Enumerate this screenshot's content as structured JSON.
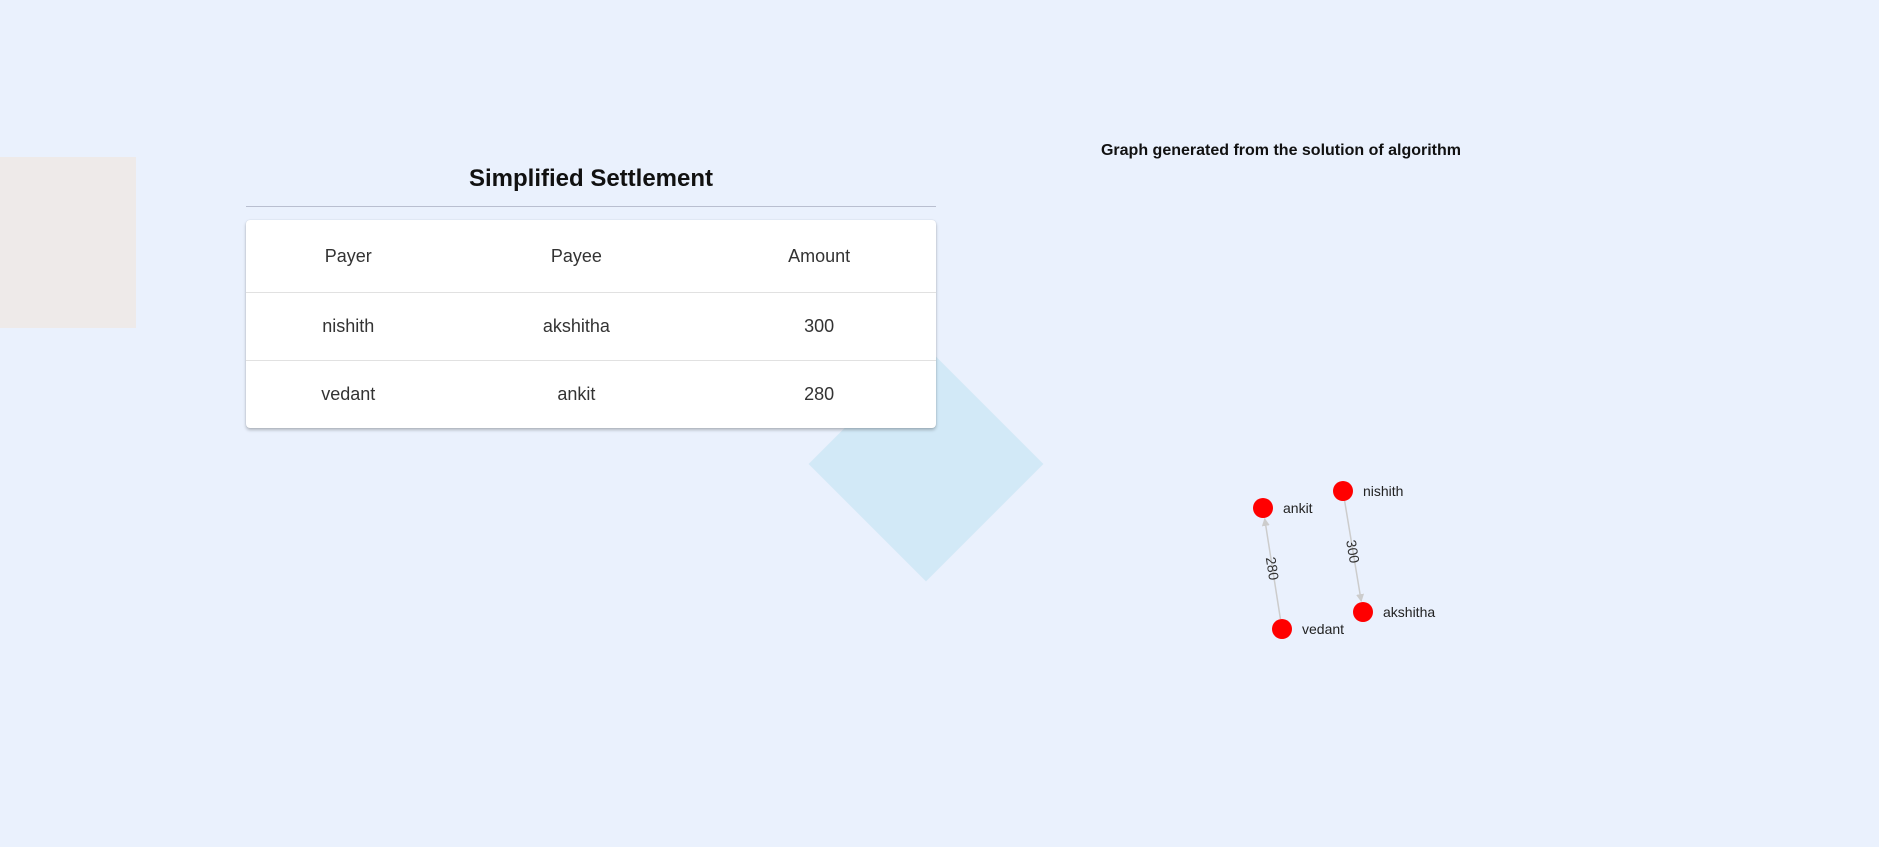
{
  "settlement": {
    "title": "Simplified Settlement",
    "columns": [
      "Payer",
      "Payee",
      "Amount"
    ],
    "rows": [
      {
        "payer": "nishith",
        "payee": "akshitha",
        "amount": "300"
      },
      {
        "payer": "vedant",
        "payee": "ankit",
        "amount": "280"
      }
    ]
  },
  "graph": {
    "title": "Graph generated from the solution of algorithm",
    "node_color": "#ff0000",
    "edge_color": "#cccccc",
    "nodes": [
      {
        "id": "ankit",
        "label": "ankit"
      },
      {
        "id": "nishith",
        "label": "nishith"
      },
      {
        "id": "vedant",
        "label": "vedant"
      },
      {
        "id": "akshitha",
        "label": "akshitha"
      }
    ],
    "edges": [
      {
        "from": "nishith",
        "to": "akshitha",
        "label": "300"
      },
      {
        "from": "vedant",
        "to": "ankit",
        "label": "280"
      }
    ]
  }
}
